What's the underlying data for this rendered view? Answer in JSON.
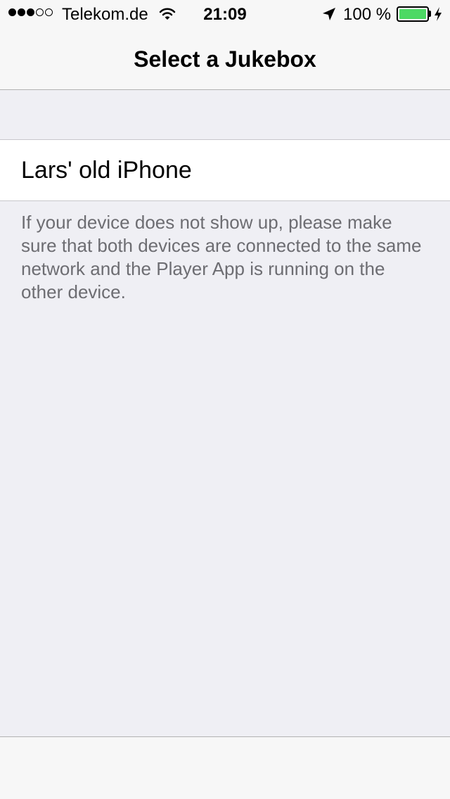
{
  "status_bar": {
    "carrier": "Telekom.de",
    "signal_bars_filled": 3,
    "signal_bars_total": 5,
    "time": "21:09",
    "battery_percent_label": "100 %",
    "battery_level": 1.0,
    "battery_color": "#4cd964",
    "icons": [
      "wifi-icon",
      "location-arrow-icon",
      "battery-icon",
      "charging-bolt-icon"
    ]
  },
  "nav": {
    "title": "Select a Jukebox"
  },
  "devices": [
    {
      "label": "Lars' old iPhone"
    }
  ],
  "footer": {
    "hint": "If your device does not show up, please make sure that both devices are connected to the same network and the Player App is running on the other device."
  },
  "colors": {
    "background": "#efeff4",
    "bar": "#f7f7f7",
    "footer_text": "#6d6d72"
  }
}
